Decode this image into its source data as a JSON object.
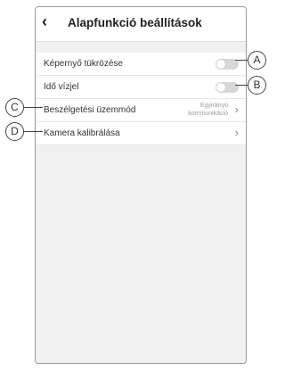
{
  "header": {
    "back_icon": "chevron-left-icon",
    "title": "Alapfunkció beállítások"
  },
  "rows": [
    {
      "label": "Képernyő tükrözése",
      "toggle_on": false
    },
    {
      "label": "Idő vízjel",
      "toggle_on": false
    },
    {
      "label": "Beszélgetési üzemmód",
      "value_line1": "Egyirányú",
      "value_line2": "kommunikáció"
    },
    {
      "label": "Kamera kalibrálása"
    }
  ],
  "callouts": {
    "a": "A",
    "b": "B",
    "c": "C",
    "d": "D"
  },
  "colors": {
    "toggle_off": "#d8d8d8",
    "background": "#f1f1f1"
  }
}
